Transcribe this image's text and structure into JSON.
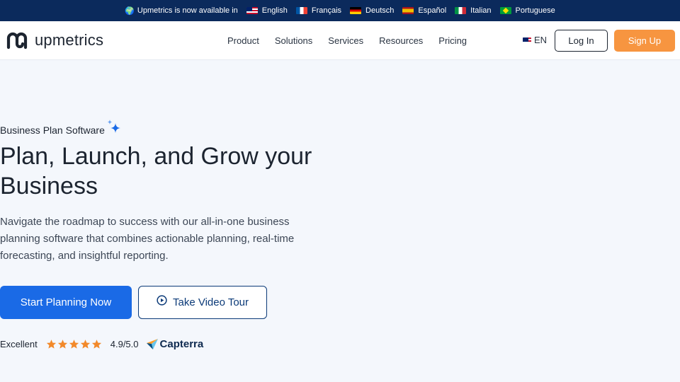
{
  "topbar": {
    "message": "Upmetrics is now available in",
    "languages": [
      {
        "label": "English",
        "flag": "flag-en"
      },
      {
        "label": "Français",
        "flag": "flag-fr"
      },
      {
        "label": "Deutsch",
        "flag": "flag-de"
      },
      {
        "label": "Español",
        "flag": "flag-es"
      },
      {
        "label": "Italian",
        "flag": "flag-it"
      },
      {
        "label": "Portuguese",
        "flag": "flag-pt"
      }
    ]
  },
  "header": {
    "logo_text": "upmetrics",
    "nav": [
      "Product",
      "Solutions",
      "Services",
      "Resources",
      "Pricing"
    ],
    "language_code": "EN",
    "login_label": "Log In",
    "signup_label": "Sign Up"
  },
  "hero": {
    "eyebrow": "Business Plan Software",
    "title_line1": "Plan, Launch, and Grow your",
    "title_line2": "Business",
    "description": "Navigate the roadmap to success with our all-in-one business planning software that combines actionable planning, real-time forecasting, and insightful reporting.",
    "primary_cta": "Start Planning Now",
    "secondary_cta": "Take Video Tour"
  },
  "rating": {
    "label": "Excellent",
    "stars": 5,
    "score": "4.9/5.0",
    "provider": "Capterra"
  },
  "colors": {
    "topbar_bg": "#0b2a5c",
    "primary_blue": "#1a6ae6",
    "signup_orange": "#f79540",
    "star_orange": "#f2892a",
    "page_bg": "#f4f7fc"
  }
}
